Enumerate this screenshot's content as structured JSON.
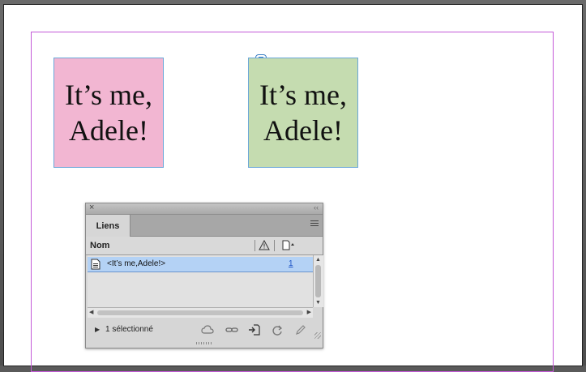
{
  "document": {
    "frames": [
      {
        "line1": "It’s me,",
        "line2": "Adele!",
        "color": "#f2b6d2"
      },
      {
        "line1": "It’s me,",
        "line2": "Adele!",
        "color": "#c5dcb0"
      }
    ],
    "margin_guide_color": "#c45ad8"
  },
  "panel": {
    "close_glyph": "×",
    "collapse_glyph": "‹‹",
    "tab_label": "Liens",
    "column_name_label": "Nom",
    "rows": [
      {
        "label": "<It’s me,Adele!>",
        "page": "1"
      }
    ],
    "footer": {
      "disclosure_glyph": "▶",
      "selection_text": "1 sélectionné"
    },
    "icons": [
      "cloud-icon",
      "relink-icon",
      "goto-link-icon",
      "update-link-icon",
      "edit-original-icon"
    ],
    "selection_color": "#b4d2f5"
  }
}
